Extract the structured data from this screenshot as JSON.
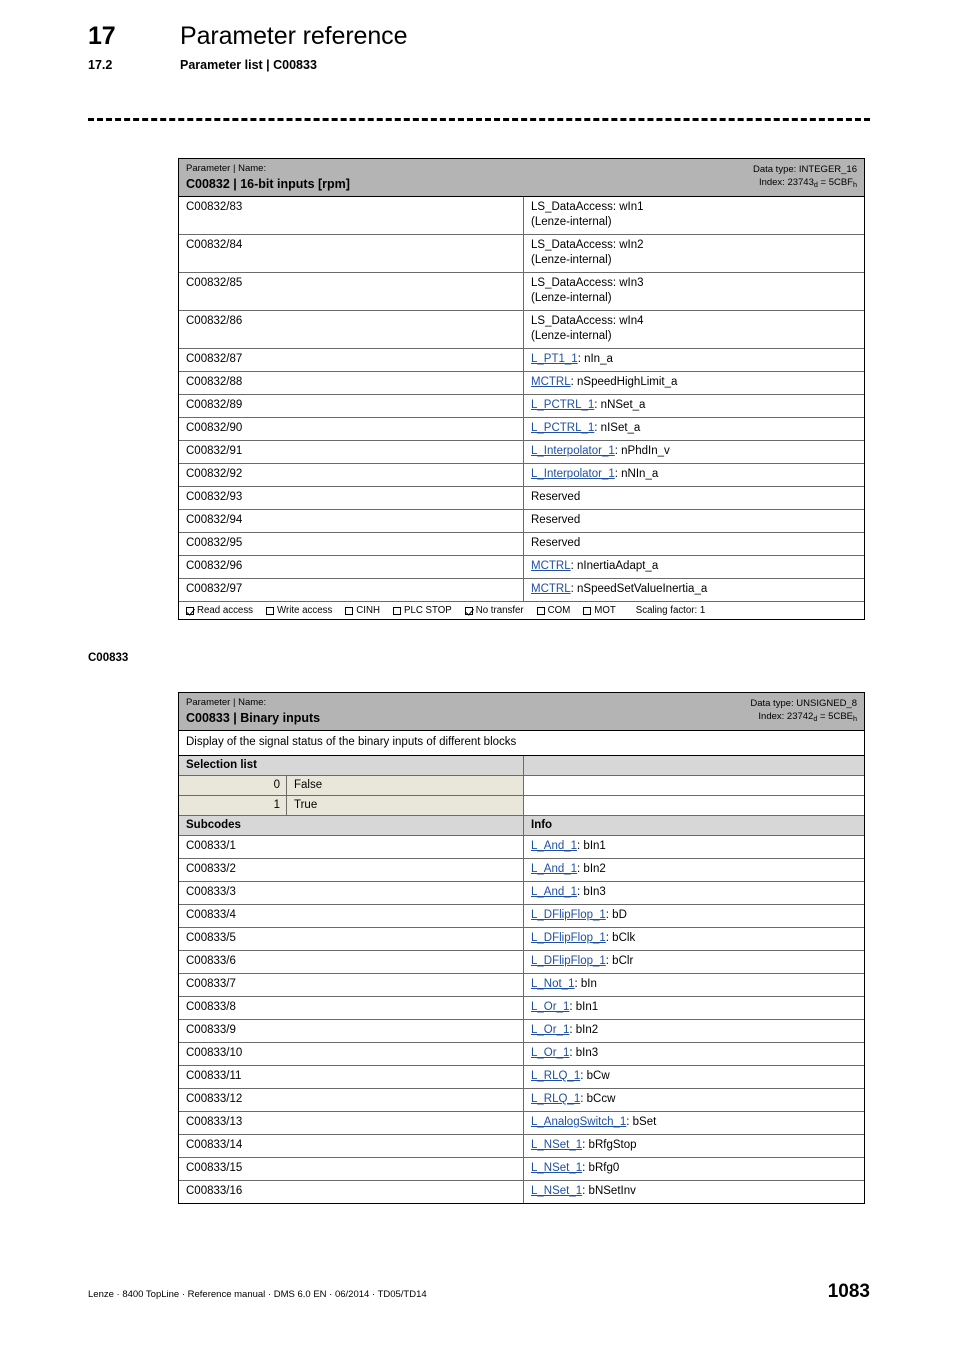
{
  "header": {
    "chapter_number": "17",
    "chapter_title": "Parameter reference",
    "section_number": "17.2",
    "section_title": "Parameter list | C00833"
  },
  "margin_label": "C00833",
  "colors": {
    "title_bar": "#b4b4b4",
    "section_header": "#d7d7d7",
    "selection_row": "#e9e7da",
    "link": "#1f4fa6"
  },
  "table_c00832": {
    "head_kicker": "Parameter | Name:",
    "head_title": "C00832 | 16-bit inputs [rpm]",
    "data_type_label": "Data type: INTEGER_16",
    "index_prefix": "Index: 23743",
    "index_sub_d": "d",
    "index_mid": " = 5CBF",
    "index_sub_h": "h",
    "rows": [
      {
        "code": "C00832/83",
        "link": "",
        "info": "LS_DataAccess: wIn1",
        "info2": "(Lenze-internal)"
      },
      {
        "code": "C00832/84",
        "link": "",
        "info": "LS_DataAccess: wIn2",
        "info2": "(Lenze-internal)"
      },
      {
        "code": "C00832/85",
        "link": "",
        "info": "LS_DataAccess: wIn3",
        "info2": "(Lenze-internal)"
      },
      {
        "code": "C00832/86",
        "link": "",
        "info": "LS_DataAccess: wIn4",
        "info2": "(Lenze-internal)"
      },
      {
        "code": "C00832/87",
        "link": "L_PT1_1",
        "info": ": nIn_a",
        "info2": ""
      },
      {
        "code": "C00832/88",
        "link": "MCTRL",
        "info": ": nSpeedHighLimit_a",
        "info2": ""
      },
      {
        "code": "C00832/89",
        "link": "L_PCTRL_1",
        "info": ": nNSet_a",
        "info2": ""
      },
      {
        "code": "C00832/90",
        "link": "L_PCTRL_1",
        "info": ": nISet_a",
        "info2": ""
      },
      {
        "code": "C00832/91",
        "link": "L_Interpolator_1",
        "info": ": nPhdIn_v",
        "info2": ""
      },
      {
        "code": "C00832/92",
        "link": "L_Interpolator_1",
        "info": ": nNIn_a",
        "info2": ""
      },
      {
        "code": "C00832/93",
        "link": "",
        "info": "Reserved",
        "info2": ""
      },
      {
        "code": "C00832/94",
        "link": "",
        "info": "Reserved",
        "info2": ""
      },
      {
        "code": "C00832/95",
        "link": "",
        "info": "Reserved",
        "info2": ""
      },
      {
        "code": "C00832/96",
        "link": "MCTRL",
        "info": ": nInertiaAdapt_a",
        "info2": ""
      },
      {
        "code": "C00832/97",
        "link": "MCTRL",
        "info": ": nSpeedSetValueInertia_a",
        "info2": ""
      }
    ],
    "legend": {
      "items": [
        {
          "label": "Read access",
          "checked": true
        },
        {
          "label": "Write access",
          "checked": false
        },
        {
          "label": "CINH",
          "checked": false
        },
        {
          "label": "PLC STOP",
          "checked": false
        },
        {
          "label": "No transfer",
          "checked": true
        },
        {
          "label": "COM",
          "checked": false
        },
        {
          "label": "MOT",
          "checked": false
        }
      ],
      "scaling": "Scaling factor: 1"
    }
  },
  "table_c00833": {
    "head_kicker": "Parameter | Name:",
    "head_title": "C00833 | Binary inputs",
    "data_type_label": "Data type: UNSIGNED_8",
    "index_prefix": "Index: 23742",
    "index_sub_d": "d",
    "index_mid": " = 5CBE",
    "index_sub_h": "h",
    "description": "Display of the signal status of the binary inputs of different blocks",
    "selection_list_header": "Selection list",
    "selection_list": [
      {
        "code": "0",
        "text": "False"
      },
      {
        "code": "1",
        "text": "True"
      }
    ],
    "subcodes_header": "Subcodes",
    "info_header": "Info",
    "rows": [
      {
        "code": "C00833/1",
        "link": "L_And_1",
        "info": ": bIn1"
      },
      {
        "code": "C00833/2",
        "link": "L_And_1",
        "info": ": bIn2"
      },
      {
        "code": "C00833/3",
        "link": "L_And_1",
        "info": ": bIn3"
      },
      {
        "code": "C00833/4",
        "link": "L_DFlipFlop_1",
        "info": ": bD"
      },
      {
        "code": "C00833/5",
        "link": "L_DFlipFlop_1",
        "info": ": bClk"
      },
      {
        "code": "C00833/6",
        "link": "L_DFlipFlop_1",
        "info": ": bClr"
      },
      {
        "code": "C00833/7",
        "link": "L_Not_1",
        "info": ": bIn"
      },
      {
        "code": "C00833/8",
        "link": "L_Or_1",
        "info": ": bIn1"
      },
      {
        "code": "C00833/9",
        "link": "L_Or_1",
        "info": ": bIn2"
      },
      {
        "code": "C00833/10",
        "link": "L_Or_1",
        "info": ": bIn3"
      },
      {
        "code": "C00833/11",
        "link": "L_RLQ_1",
        "info": ": bCw"
      },
      {
        "code": "C00833/12",
        "link": "L_RLQ_1",
        "info": ": bCcw"
      },
      {
        "code": "C00833/13",
        "link": "L_AnalogSwitch_1",
        "info": ": bSet"
      },
      {
        "code": "C00833/14",
        "link": "L_NSet_1",
        "info": ": bRfgStop"
      },
      {
        "code": "C00833/15",
        "link": "L_NSet_1",
        "info": ": bRfg0"
      },
      {
        "code": "C00833/16",
        "link": "L_NSet_1",
        "info": ": bNSetInv"
      }
    ]
  },
  "footer": {
    "text": "Lenze · 8400 TopLine · Reference manual · DMS 6.0 EN · 06/2014 · TD05/TD14",
    "page": "1083"
  }
}
